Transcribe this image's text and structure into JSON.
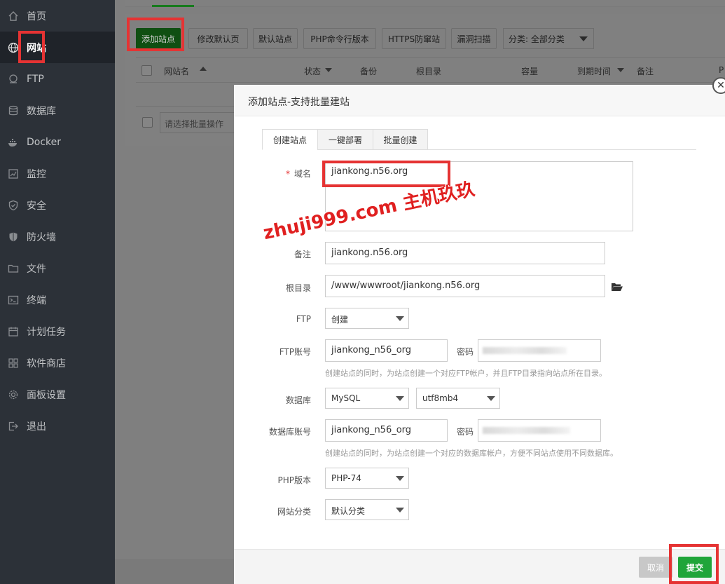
{
  "sidebar": {
    "items": [
      {
        "label": "首页",
        "icon": "home-icon"
      },
      {
        "label": "网站",
        "icon": "globe-icon"
      },
      {
        "label": "FTP",
        "icon": "ftp-icon"
      },
      {
        "label": "数据库",
        "icon": "database-icon"
      },
      {
        "label": "Docker",
        "icon": "docker-icon"
      },
      {
        "label": "监控",
        "icon": "monitor-icon"
      },
      {
        "label": "安全",
        "icon": "shield-icon"
      },
      {
        "label": "防火墙",
        "icon": "firewall-icon"
      },
      {
        "label": "文件",
        "icon": "folder-icon"
      },
      {
        "label": "终端",
        "icon": "terminal-icon"
      },
      {
        "label": "计划任务",
        "icon": "calendar-icon"
      },
      {
        "label": "软件商店",
        "icon": "grid-icon"
      },
      {
        "label": "面板设置",
        "icon": "gear-icon"
      },
      {
        "label": "退出",
        "icon": "logout-icon"
      }
    ],
    "active_index": 1
  },
  "toolbar": {
    "add_site": "添加站点",
    "edit_default_page": "修改默认页",
    "default_site": "默认站点",
    "php_cli_version": "PHP命令行版本",
    "https_guard": "HTTPS防窜站",
    "vuln_scan": "漏洞扫描",
    "category_select": "分类: 全部分类"
  },
  "table": {
    "headers": [
      "网站名",
      "状态",
      "备份",
      "根目录",
      "容量",
      "到期时间",
      "备注",
      "P"
    ],
    "batch_placeholder": "请选择批量操作"
  },
  "modal": {
    "title": "添加站点-支持批量建站",
    "tabs": [
      "创建站点",
      "一键部署",
      "批量创建"
    ],
    "domain_label": "域名",
    "domain_value": "jiankong.n56.org",
    "remark_label": "备注",
    "remark_value": "jiankong.n56.org",
    "root_label": "根目录",
    "root_value": "/www/wwwroot/jiankong.n56.org",
    "ftp_label": "FTP",
    "ftp_value": "创建",
    "ftp_account_label": "FTP账号",
    "ftp_account_value": "jiankong_n56_org",
    "password_label": "密码",
    "ftp_hint": "创建站点的同时，为站点创建一个对应FTP帐户，并且FTP目录指向站点所在目录。",
    "db_label": "数据库",
    "db_value": "MySQL",
    "db_charset": "utf8mb4",
    "db_account_label": "数据库账号",
    "db_account_value": "jiankong_n56_org",
    "db_hint": "创建站点的同时，为站点创建一个对应的数据库帐户，方便不同站点使用不同数据库。",
    "php_label": "PHP版本",
    "php_value": "PHP-74",
    "category_label": "网站分类",
    "category_value": "默认分类",
    "cancel": "取消",
    "submit": "提交"
  },
  "watermark": "zhuji999.com 主机玖玖"
}
